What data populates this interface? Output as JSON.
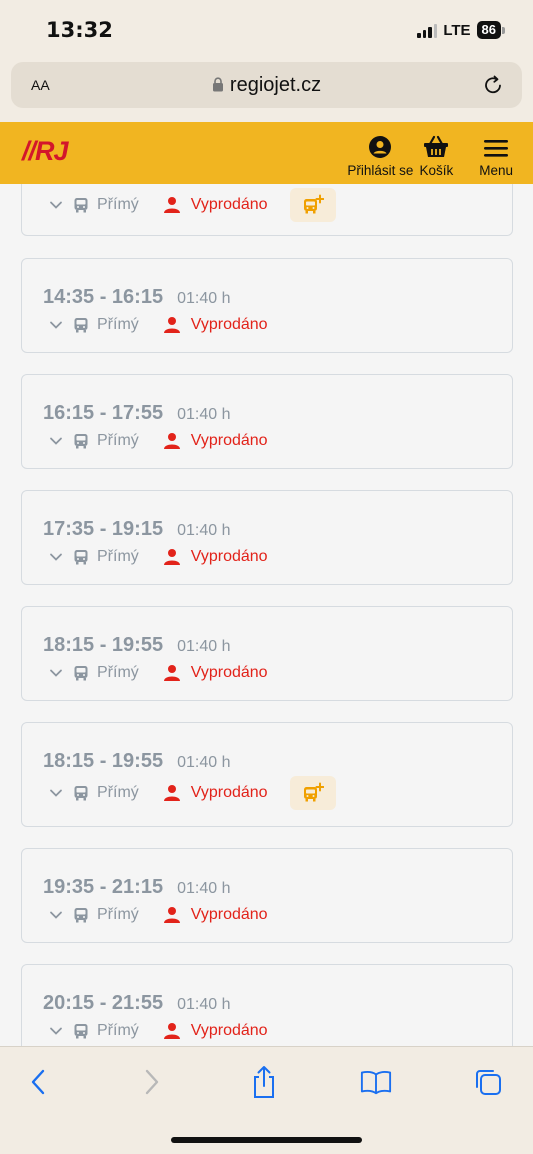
{
  "status_bar": {
    "time": "13:32",
    "network": "LTE",
    "battery": "86"
  },
  "browser": {
    "aa_label": "AA",
    "url": "regiojet.cz"
  },
  "site_header": {
    "logo_text": "RJ",
    "login_label": "Přihlásit se",
    "cart_label": "Košík",
    "menu_label": "Menu"
  },
  "colors": {
    "header_bg": "#f1b521",
    "logo_red": "#d3162b",
    "logo_blue": "#1a3f8f",
    "soldout_red": "#e2231a",
    "muted_text": "#8c96a0",
    "extra_bus_orange": "#f0a000"
  },
  "routes": [
    {
      "times": "",
      "duration": "",
      "type": "Přímý",
      "status": "Vyprodáno",
      "extra_bus": true
    },
    {
      "times": "14:35 - 16:15",
      "duration": "01:40 h",
      "type": "Přímý",
      "status": "Vyprodáno",
      "extra_bus": false
    },
    {
      "times": "16:15 - 17:55",
      "duration": "01:40 h",
      "type": "Přímý",
      "status": "Vyprodáno",
      "extra_bus": false
    },
    {
      "times": "17:35 - 19:15",
      "duration": "01:40 h",
      "type": "Přímý",
      "status": "Vyprodáno",
      "extra_bus": false
    },
    {
      "times": "18:15 - 19:55",
      "duration": "01:40 h",
      "type": "Přímý",
      "status": "Vyprodáno",
      "extra_bus": false
    },
    {
      "times": "18:15 - 19:55",
      "duration": "01:40 h",
      "type": "Přímý",
      "status": "Vyprodáno",
      "extra_bus": true
    },
    {
      "times": "19:35 - 21:15",
      "duration": "01:40 h",
      "type": "Přímý",
      "status": "Vyprodáno",
      "extra_bus": false
    },
    {
      "times": "20:15 - 21:55",
      "duration": "01:40 h",
      "type": "Přímý",
      "status": "Vyprodáno",
      "extra_bus": false
    }
  ],
  "toolbar": {
    "icons": [
      "back-icon",
      "forward-icon",
      "share-icon",
      "bookmarks-icon",
      "tabs-icon"
    ]
  }
}
